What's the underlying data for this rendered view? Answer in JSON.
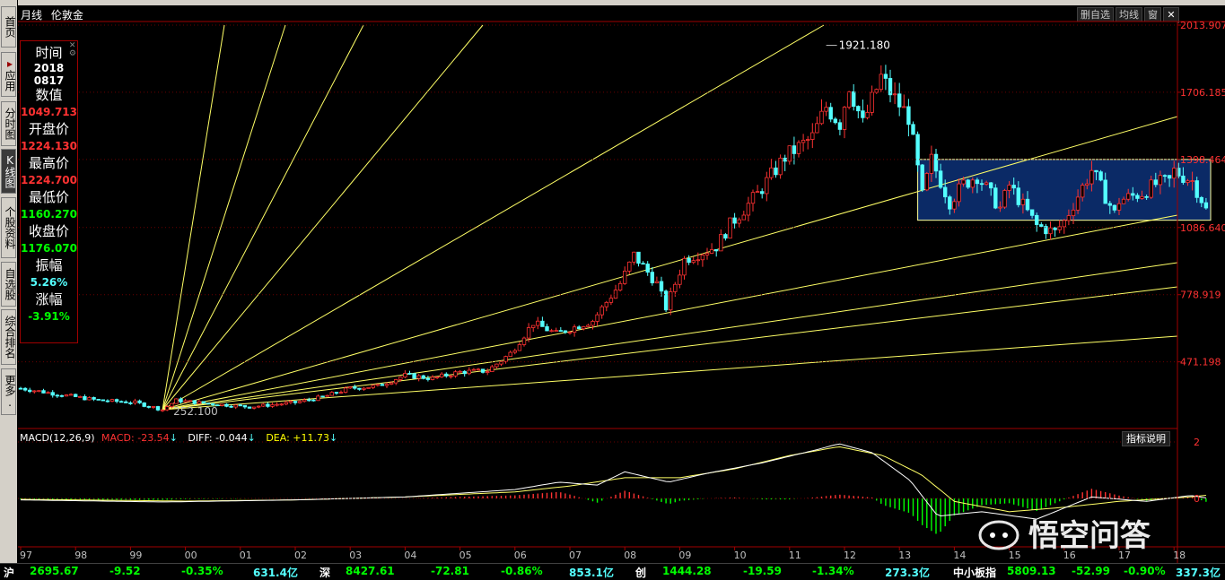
{
  "chart_title": {
    "period": "月线",
    "name": "伦敦金"
  },
  "nav": [
    {
      "label": "首页"
    },
    {
      "label": "应用"
    },
    {
      "label": "分时图"
    },
    {
      "label": "K线图"
    },
    {
      "label": "个股资料"
    },
    {
      "label": "自选股"
    },
    {
      "label": "综合排名"
    },
    {
      "label": "更多."
    }
  ],
  "top_buttons": {
    "delete_self": "删自选",
    "ma": "均线",
    "window": "窗",
    "close": "✕"
  },
  "info": {
    "time_label": "时间",
    "time_year": "2018",
    "time_md": "0817",
    "value_label": "数值",
    "value": "1049.713",
    "open_label": "开盘价",
    "open": "1224.130",
    "high_label": "最高价",
    "high": "1224.700",
    "low_label": "最低价",
    "low": "1160.270",
    "close_label": "收盘价",
    "close": "1176.070",
    "amp_label": "振幅",
    "amp": "5.26%",
    "chg_label": "涨幅",
    "chg": "-3.91%"
  },
  "macd_legend": {
    "name": "MACD(12,26,9)",
    "macd": "MACD: -23.54",
    "diff": "DIFF: -0.044",
    "dea": "DEA: +11.73",
    "arrow": "↓"
  },
  "indicator_button": "指标说明",
  "colors": {
    "up": "#ff3232",
    "down": "#54ffff",
    "gann": "#ffff66",
    "rect": "#0b2a66",
    "axis": "#a00000"
  },
  "chart_data": {
    "type": "candlestick",
    "symbol": "伦敦金",
    "period": "月线",
    "x_ticks": [
      "97",
      "98",
      "99",
      "00",
      "01",
      "02",
      "03",
      "04",
      "05",
      "06",
      "07",
      "08",
      "09",
      "10",
      "11",
      "12",
      "13",
      "14",
      "15",
      "16",
      "17",
      "18"
    ],
    "x_tick_years": [
      1997,
      1998,
      1999,
      2000,
      2001,
      2002,
      2003,
      2004,
      2005,
      2006,
      2007,
      2008,
      2009,
      2010,
      2011,
      2012,
      2013,
      2014,
      2015,
      2016,
      2017,
      2018
    ],
    "y_ticks": [
      "2013.907",
      "1706.185",
      "1398.464",
      "1086.640",
      "778.919",
      "471.198"
    ],
    "y_tick_values": [
      2013.907,
      1706.185,
      1398.464,
      1086.64,
      778.919,
      471.198
    ],
    "ylim": [
      150,
      2050
    ],
    "annotations": [
      {
        "text": "1921.180",
        "date": "2011-09",
        "value": 1921.18
      },
      {
        "text": "252.100",
        "date": "1999-08",
        "value": 252.1
      }
    ],
    "anchors": [
      [
        "1997-01",
        350
      ],
      [
        "1997-10",
        320
      ],
      [
        "1998-06",
        295
      ],
      [
        "1999-02",
        285
      ],
      [
        "1999-08",
        252.1
      ],
      [
        "1999-11",
        295
      ],
      [
        "2000-06",
        280
      ],
      [
        "2001-03",
        265
      ],
      [
        "2002-01",
        285
      ],
      [
        "2002-07",
        310
      ],
      [
        "2003-01",
        350
      ],
      [
        "2003-07",
        360
      ],
      [
        "2004-01",
        410
      ],
      [
        "2004-07",
        395
      ],
      [
        "2005-01",
        425
      ],
      [
        "2005-07",
        430
      ],
      [
        "2005-12",
        510
      ],
      [
        "2006-05",
        650
      ],
      [
        "2006-10",
        600
      ],
      [
        "2007-06",
        660
      ],
      [
        "2007-12",
        830
      ],
      [
        "2008-03",
        960
      ],
      [
        "2008-08",
        830
      ],
      [
        "2008-10",
        720
      ],
      [
        "2009-02",
        940
      ],
      [
        "2009-09",
        1000
      ],
      [
        "2009-12",
        1100
      ],
      [
        "2010-06",
        1240
      ],
      [
        "2010-12",
        1410
      ],
      [
        "2011-06",
        1500
      ],
      [
        "2011-09",
        1640
      ],
      [
        "2011-12",
        1565
      ],
      [
        "2012-02",
        1740
      ],
      [
        "2012-05",
        1560
      ],
      [
        "2012-09",
        1775
      ],
      [
        "2012-12",
        1675
      ],
      [
        "2013-03",
        1595
      ],
      [
        "2013-06",
        1230
      ],
      [
        "2013-08",
        1395
      ],
      [
        "2013-12",
        1205
      ],
      [
        "2014-03",
        1285
      ],
      [
        "2014-06",
        1325
      ],
      [
        "2014-11",
        1175
      ],
      [
        "2015-01",
        1280
      ],
      [
        "2015-07",
        1095
      ],
      [
        "2015-11",
        1065
      ],
      [
        "2016-01",
        1115
      ],
      [
        "2016-07",
        1350
      ],
      [
        "2016-12",
        1150
      ],
      [
        "2017-01",
        1210
      ],
      [
        "2017-06",
        1245
      ],
      [
        "2017-09",
        1285
      ],
      [
        "2017-12",
        1300
      ],
      [
        "2018-01",
        1345
      ],
      [
        "2018-05",
        1300
      ],
      [
        "2018-08",
        1176.07
      ]
    ],
    "gann_fan": {
      "origin": {
        "date": "1999-08",
        "value": 252.1
      }
    },
    "channel_box": {
      "start": "2013-05",
      "end": "2018-09",
      "top": 1398.464,
      "bottom": 1120
    },
    "macd": {
      "params": "12,26,9",
      "MACD": -23.54,
      "DIFF": -0.044,
      "DEA": 11.73,
      "y_ticks": [
        "2",
        "0"
      ],
      "diff_anchors": [
        [
          1997,
          -5
        ],
        [
          1999.6,
          -12
        ],
        [
          2002,
          -5
        ],
        [
          2004,
          5
        ],
        [
          2006,
          30
        ],
        [
          2006.8,
          55
        ],
        [
          2007.5,
          45
        ],
        [
          2008,
          90
        ],
        [
          2008.8,
          55
        ],
        [
          2009.5,
          85
        ],
        [
          2010.5,
          120
        ],
        [
          2011.5,
          165
        ],
        [
          2011.9,
          185
        ],
        [
          2012.5,
          155
        ],
        [
          2013.2,
          60
        ],
        [
          2013.7,
          -60
        ],
        [
          2014.5,
          -45
        ],
        [
          2015.5,
          -70
        ],
        [
          2016.5,
          5
        ],
        [
          2017.5,
          -10
        ],
        [
          2018.3,
          10
        ],
        [
          2018.65,
          0
        ]
      ],
      "dea_anchors": [
        [
          1997,
          -3
        ],
        [
          2000,
          -9
        ],
        [
          2002,
          -5
        ],
        [
          2004,
          5
        ],
        [
          2006,
          22
        ],
        [
          2007,
          42
        ],
        [
          2008,
          70
        ],
        [
          2009,
          70
        ],
        [
          2010,
          100
        ],
        [
          2011,
          145
        ],
        [
          2011.9,
          175
        ],
        [
          2012.7,
          145
        ],
        [
          2013.4,
          80
        ],
        [
          2014,
          -10
        ],
        [
          2015,
          -45
        ],
        [
          2016,
          -30
        ],
        [
          2017,
          -10
        ],
        [
          2018.3,
          5
        ],
        [
          2018.65,
          12
        ]
      ]
    }
  },
  "status_bar": [
    {
      "name": "沪",
      "value": "2695.67",
      "change": "-9.52",
      "pct": "-0.35%",
      "amount": "631.4亿"
    },
    {
      "name": "深",
      "value": "8427.61",
      "change": "-72.81",
      "pct": "-0.86%",
      "amount": "853.1亿"
    },
    {
      "name": "创",
      "value": "1444.28",
      "change": "-19.59",
      "pct": "-1.34%",
      "amount": "273.3亿"
    },
    {
      "name": "中小板指",
      "value": "5809.13",
      "change": "-52.99",
      "pct": "-0.90%",
      "amount": "337.3亿"
    }
  ],
  "watermark": "悟空问答"
}
